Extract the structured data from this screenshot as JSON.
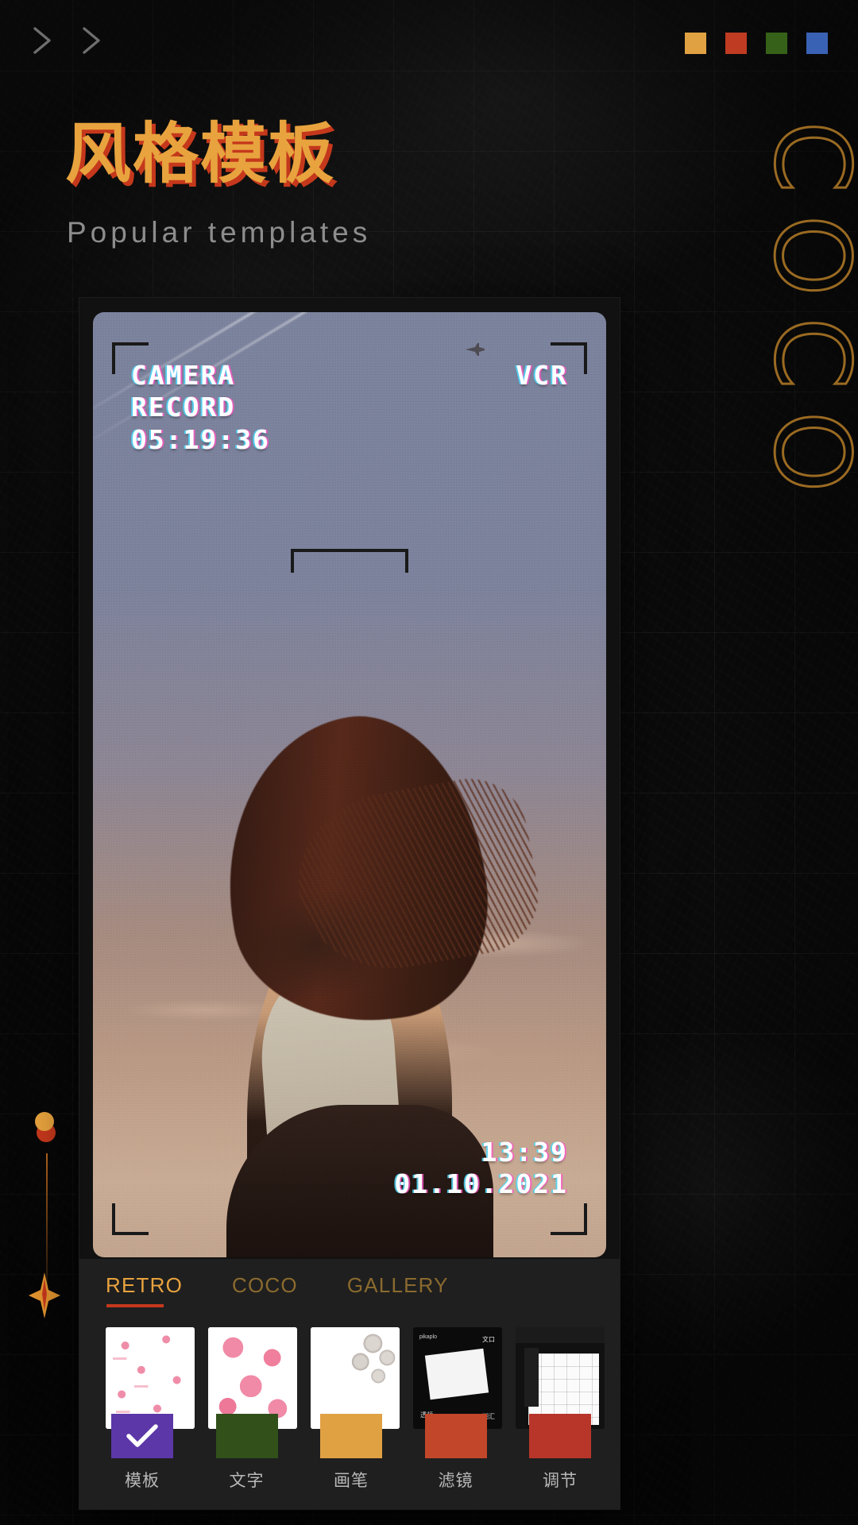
{
  "header": {
    "nav_icons": [
      "chevron-right-icon",
      "chevron-right-icon"
    ],
    "palette_swatches": [
      {
        "name": "amber",
        "color": "#e0a143"
      },
      {
        "name": "red",
        "color": "#bf3b22"
      },
      {
        "name": "green",
        "color": "#356118"
      },
      {
        "name": "blue",
        "color": "#3a62b4"
      }
    ]
  },
  "hero": {
    "title_cn": "风格模板",
    "title_en": "Popular templates",
    "title_color": "#e8a33e",
    "title_shadow_color": "#c5381c",
    "decor_letters": [
      "C",
      "O",
      "C",
      "O"
    ],
    "decor_color": "#9a6a22"
  },
  "preview": {
    "overlay_label": "CAMERA",
    "overlay_status": "RECORD",
    "overlay_time": "05:19:36",
    "overlay_mode": "VCR",
    "stamp_time": "13:39",
    "stamp_date": "01.10.2021"
  },
  "tabs": [
    {
      "label": "RETRO",
      "active": true
    },
    {
      "label": "COCO",
      "active": false
    },
    {
      "label": "GALLERY",
      "active": false
    }
  ],
  "tab_colors": {
    "active": "#e8a33e",
    "inactive": "#8a6a2e",
    "underline": "#c5381c"
  },
  "thumbnails": [
    {
      "name": "thumb-hearts-small"
    },
    {
      "name": "thumb-hearts-large"
    },
    {
      "name": "thumb-pearls"
    },
    {
      "name": "thumb-dark-polaroid",
      "tag1": "pikaplo",
      "tag2": "文口",
      "tag3": "透频",
      "tag4": "潮汇"
    },
    {
      "name": "thumb-phone-grid"
    }
  ],
  "tools": [
    {
      "label": "模板",
      "color": "#5b37a8",
      "selected": true,
      "icon": "check-icon"
    },
    {
      "label": "文字",
      "color": "#31501a",
      "selected": false,
      "icon": ""
    },
    {
      "label": "画笔",
      "color": "#e0a143",
      "selected": false,
      "icon": ""
    },
    {
      "label": "滤镜",
      "color": "#c2462a",
      "selected": false,
      "icon": ""
    },
    {
      "label": "调节",
      "color": "#b8352a",
      "selected": false,
      "icon": ""
    }
  ]
}
